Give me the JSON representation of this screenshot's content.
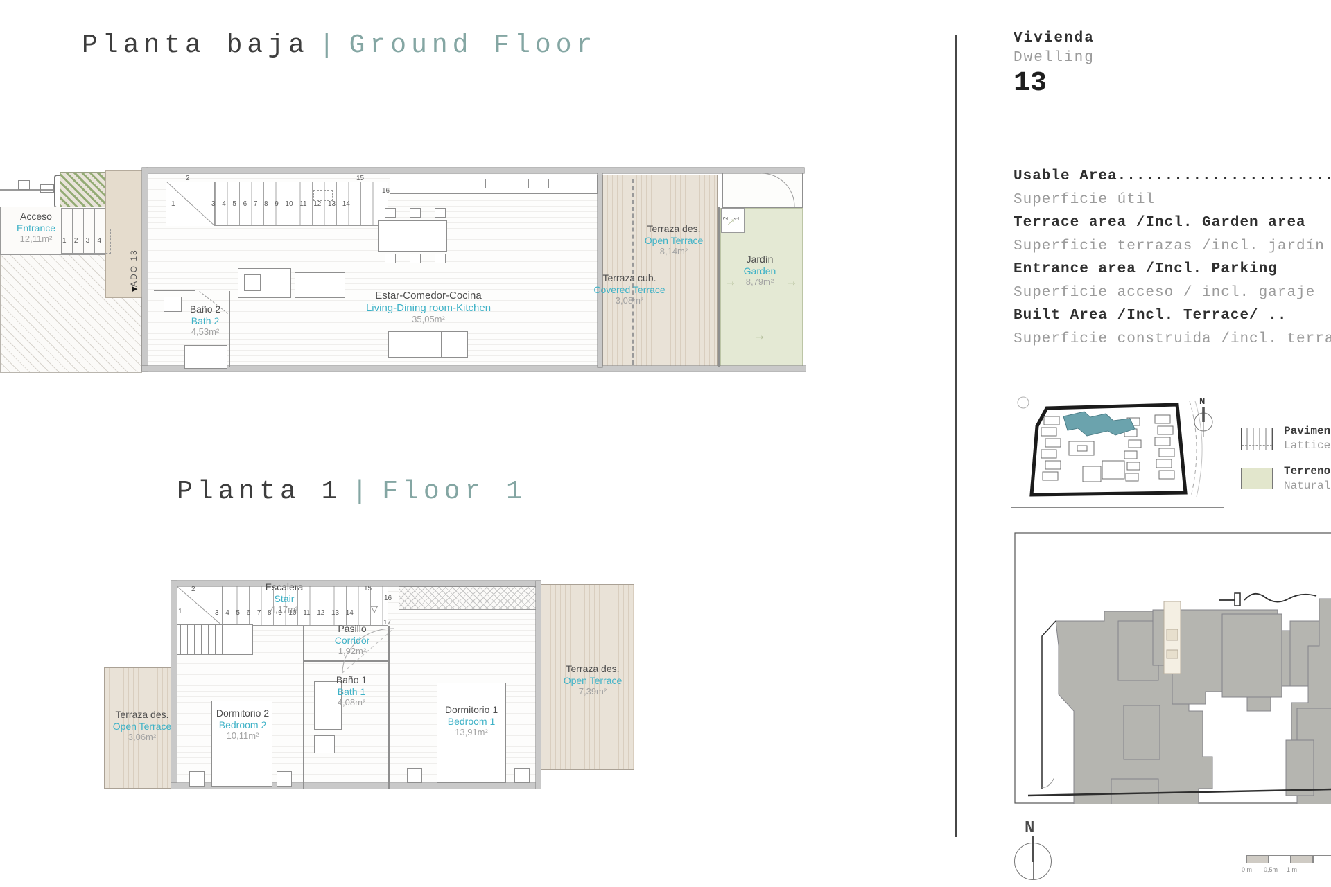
{
  "titles": {
    "ground_es": "Planta baja",
    "ground_en": "Ground Floor",
    "floor1_es": "Planta 1",
    "floor1_en": "Floor 1",
    "sep": "|"
  },
  "icons": {
    "arrow": "→",
    "triangle_right": "▶",
    "triangle_down": "▽"
  },
  "ground_plan": {
    "ado_label": "ADO 13",
    "rooms": [
      {
        "es": "Acceso",
        "en": "Entrance",
        "area": "12,11m²"
      },
      {
        "es": "Baño 2",
        "en": "Bath 2",
        "area": "4,53m²"
      },
      {
        "es": "Estar-Comedor-Cocina",
        "en": "Living-Dining room-Kitchen",
        "area": "35,05m²"
      },
      {
        "es": "Terraza des.",
        "en": "Open Terrace",
        "area": "8,14m²"
      },
      {
        "es": "Terraza cub.",
        "en": "Covered Terrace",
        "area": "3,08m²"
      },
      {
        "es": "Jardín",
        "en": "Garden",
        "area": "8,79m²"
      }
    ],
    "stair_numbers": [
      "1",
      "2",
      "3",
      "4",
      "5",
      "6",
      "7",
      "8",
      "9",
      "10",
      "11",
      "12",
      "13",
      "14",
      "15",
      "16"
    ],
    "entrance_steps": [
      "1",
      "2",
      "3",
      "4"
    ],
    "garden_steps": [
      "2",
      "1"
    ]
  },
  "floor1_plan": {
    "rooms": [
      {
        "es": "Escalera",
        "en": "Stair",
        "area": "4,17m²"
      },
      {
        "es": "Pasillo",
        "en": "Corridor",
        "area": "1,92m²"
      },
      {
        "es": "Dormitorio 2",
        "en": "Bedroom 2",
        "area": "10,11m²"
      },
      {
        "es": "Baño 1",
        "en": "Bath 1",
        "area": "4,08m²"
      },
      {
        "es": "Dormitorio 1",
        "en": "Bedroom 1",
        "area": "13,91m²"
      },
      {
        "es": "Terraza des.",
        "en": "Open Terrace",
        "area": "7,39m²"
      },
      {
        "es": "Terraza des.",
        "en": "Open Terrace",
        "area": "3,06m²"
      }
    ],
    "stair_numbers": [
      "1",
      "2",
      "3",
      "4",
      "5",
      "6",
      "7",
      "8",
      "9",
      "10",
      "11",
      "12",
      "13",
      "14",
      "15",
      "16",
      "17"
    ]
  },
  "info_panel": {
    "dwelling_es": "Vivienda",
    "dwelling_en": "Dwelling",
    "dwelling_number": "13",
    "areas": [
      {
        "en": "Usable Area........................",
        "es": "Superficie útil"
      },
      {
        "en": "Terrace area /Incl. Garden area",
        "es": "Superficie terrazas /incl. jardín"
      },
      {
        "en": "Entrance area /Incl. Parking",
        "es": "Superficie acceso / incl. garaje"
      },
      {
        "en": "Built Area /Incl. Terrace/ ..",
        "es": "Superficie construida /incl. terraza"
      }
    ],
    "legend": [
      {
        "line1": "Pavimento",
        "line2": "Lattice pa"
      },
      {
        "line1": "Terreno n",
        "line2": "Natural gr"
      }
    ],
    "compass_n": "N",
    "scale_labels": [
      "0 m",
      "0,5m",
      "1 m"
    ]
  }
}
